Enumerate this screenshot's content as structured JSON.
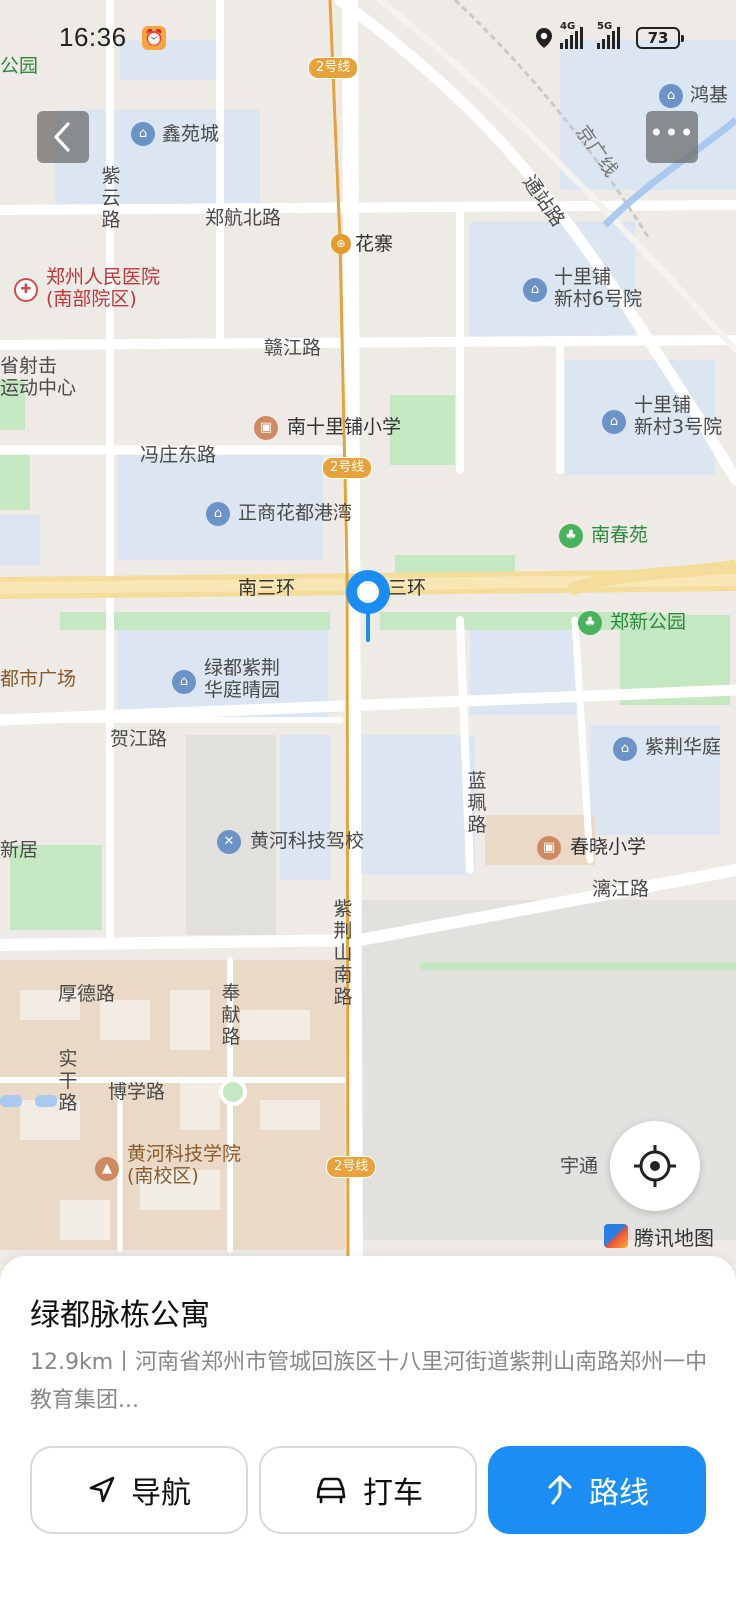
{
  "status_bar": {
    "time": "16:36",
    "network1": "4G",
    "network2": "5G",
    "battery": "73"
  },
  "map": {
    "metro_line_tag": "2号线",
    "roads": {
      "zhenghang_north": "郑航北路",
      "ganjiang": "赣江路",
      "fengzhuang_east": "冯庄东路",
      "nansanhuan_left": "南三环",
      "nansanhuan_right": "三环",
      "hejiang": "贺江路",
      "ziyun": "紫云路",
      "tongzhan": "通站路",
      "jingguang": "京广线",
      "lanpei": "蓝珮路",
      "lijiang": "漓江路",
      "zijingshan_south": "紫荆山南路",
      "houde": "厚德路",
      "fengxian": "奉献路",
      "shigan": "实干路",
      "boxue": "博学路"
    },
    "pois": {
      "xinyuancheng": "鑫苑城",
      "hongji": "鸿基",
      "huazhai": "花寨",
      "hospital_line1": "郑州人民医院",
      "hospital_line2": "(南部院区)",
      "shili_6_line1": "十里铺",
      "shili_6_line2": "新村6号院",
      "sheji_line1": "省射击",
      "sheji_line2": "运动中心",
      "nanshilipu_school": "南十里铺小学",
      "shili_3_line1": "十里铺",
      "shili_3_line2": "新村3号院",
      "zhengshang": "正商花都港湾",
      "nanchunyuan": "南春苑",
      "zhengxin_park": "郑新公园",
      "dushi_plaza": "都市广场",
      "lvdu_line1": "绿都紫荆",
      "lvdu_line2": "华庭晴园",
      "zijing_huating": "紫荆华庭",
      "xinju": "新居",
      "drive_school": "黄河科技驾校",
      "chunxiao_school": "春晓小学",
      "college_line1": "黄河科技学院",
      "college_line2": "(南校区)",
      "yutong": "宇通",
      "gongyuan_partial": "公园"
    },
    "brand": "腾讯地图",
    "colors": {
      "metro_line": "#e8a23a",
      "pin": "#1a8ef5",
      "water_blue": "#dce6f2",
      "park_green": "#c5e8c3"
    }
  },
  "sheet": {
    "title": "绿都脉栋公寓",
    "address": "12.9km丨河南省郑州市管城回族区十八里河街道紫荆山南路郑州一中教育集团...",
    "buttons": {
      "navigate": "导航",
      "taxi": "打车",
      "route": "路线"
    },
    "accent_color": "#1a8ef5"
  }
}
